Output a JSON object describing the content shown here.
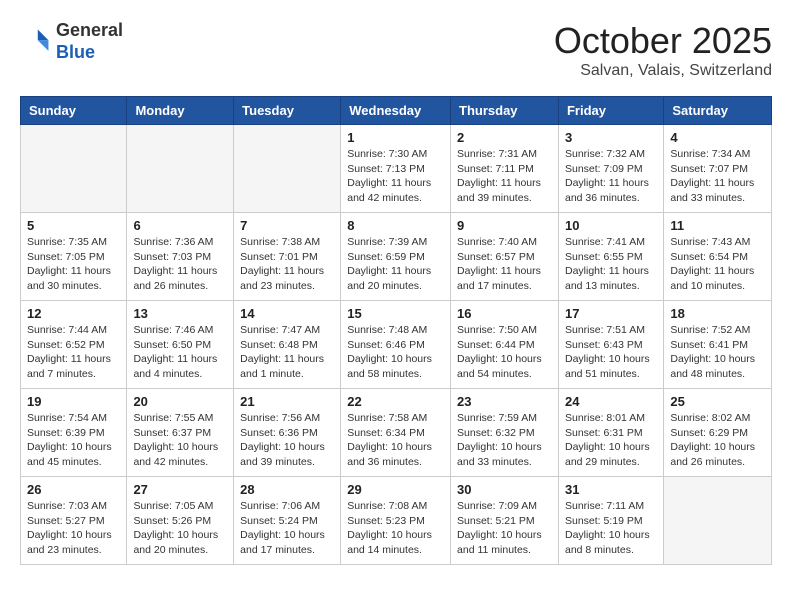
{
  "header": {
    "logo_general": "General",
    "logo_blue": "Blue",
    "month": "October 2025",
    "location": "Salvan, Valais, Switzerland"
  },
  "days_of_week": [
    "Sunday",
    "Monday",
    "Tuesday",
    "Wednesday",
    "Thursday",
    "Friday",
    "Saturday"
  ],
  "weeks": [
    [
      {
        "day": "",
        "info": ""
      },
      {
        "day": "",
        "info": ""
      },
      {
        "day": "",
        "info": ""
      },
      {
        "day": "1",
        "info": "Sunrise: 7:30 AM\nSunset: 7:13 PM\nDaylight: 11 hours\nand 42 minutes."
      },
      {
        "day": "2",
        "info": "Sunrise: 7:31 AM\nSunset: 7:11 PM\nDaylight: 11 hours\nand 39 minutes."
      },
      {
        "day": "3",
        "info": "Sunrise: 7:32 AM\nSunset: 7:09 PM\nDaylight: 11 hours\nand 36 minutes."
      },
      {
        "day": "4",
        "info": "Sunrise: 7:34 AM\nSunset: 7:07 PM\nDaylight: 11 hours\nand 33 minutes."
      }
    ],
    [
      {
        "day": "5",
        "info": "Sunrise: 7:35 AM\nSunset: 7:05 PM\nDaylight: 11 hours\nand 30 minutes."
      },
      {
        "day": "6",
        "info": "Sunrise: 7:36 AM\nSunset: 7:03 PM\nDaylight: 11 hours\nand 26 minutes."
      },
      {
        "day": "7",
        "info": "Sunrise: 7:38 AM\nSunset: 7:01 PM\nDaylight: 11 hours\nand 23 minutes."
      },
      {
        "day": "8",
        "info": "Sunrise: 7:39 AM\nSunset: 6:59 PM\nDaylight: 11 hours\nand 20 minutes."
      },
      {
        "day": "9",
        "info": "Sunrise: 7:40 AM\nSunset: 6:57 PM\nDaylight: 11 hours\nand 17 minutes."
      },
      {
        "day": "10",
        "info": "Sunrise: 7:41 AM\nSunset: 6:55 PM\nDaylight: 11 hours\nand 13 minutes."
      },
      {
        "day": "11",
        "info": "Sunrise: 7:43 AM\nSunset: 6:54 PM\nDaylight: 11 hours\nand 10 minutes."
      }
    ],
    [
      {
        "day": "12",
        "info": "Sunrise: 7:44 AM\nSunset: 6:52 PM\nDaylight: 11 hours\nand 7 minutes."
      },
      {
        "day": "13",
        "info": "Sunrise: 7:46 AM\nSunset: 6:50 PM\nDaylight: 11 hours\nand 4 minutes."
      },
      {
        "day": "14",
        "info": "Sunrise: 7:47 AM\nSunset: 6:48 PM\nDaylight: 11 hours\nand 1 minute."
      },
      {
        "day": "15",
        "info": "Sunrise: 7:48 AM\nSunset: 6:46 PM\nDaylight: 10 hours\nand 58 minutes."
      },
      {
        "day": "16",
        "info": "Sunrise: 7:50 AM\nSunset: 6:44 PM\nDaylight: 10 hours\nand 54 minutes."
      },
      {
        "day": "17",
        "info": "Sunrise: 7:51 AM\nSunset: 6:43 PM\nDaylight: 10 hours\nand 51 minutes."
      },
      {
        "day": "18",
        "info": "Sunrise: 7:52 AM\nSunset: 6:41 PM\nDaylight: 10 hours\nand 48 minutes."
      }
    ],
    [
      {
        "day": "19",
        "info": "Sunrise: 7:54 AM\nSunset: 6:39 PM\nDaylight: 10 hours\nand 45 minutes."
      },
      {
        "day": "20",
        "info": "Sunrise: 7:55 AM\nSunset: 6:37 PM\nDaylight: 10 hours\nand 42 minutes."
      },
      {
        "day": "21",
        "info": "Sunrise: 7:56 AM\nSunset: 6:36 PM\nDaylight: 10 hours\nand 39 minutes."
      },
      {
        "day": "22",
        "info": "Sunrise: 7:58 AM\nSunset: 6:34 PM\nDaylight: 10 hours\nand 36 minutes."
      },
      {
        "day": "23",
        "info": "Sunrise: 7:59 AM\nSunset: 6:32 PM\nDaylight: 10 hours\nand 33 minutes."
      },
      {
        "day": "24",
        "info": "Sunrise: 8:01 AM\nSunset: 6:31 PM\nDaylight: 10 hours\nand 29 minutes."
      },
      {
        "day": "25",
        "info": "Sunrise: 8:02 AM\nSunset: 6:29 PM\nDaylight: 10 hours\nand 26 minutes."
      }
    ],
    [
      {
        "day": "26",
        "info": "Sunrise: 7:03 AM\nSunset: 5:27 PM\nDaylight: 10 hours\nand 23 minutes."
      },
      {
        "day": "27",
        "info": "Sunrise: 7:05 AM\nSunset: 5:26 PM\nDaylight: 10 hours\nand 20 minutes."
      },
      {
        "day": "28",
        "info": "Sunrise: 7:06 AM\nSunset: 5:24 PM\nDaylight: 10 hours\nand 17 minutes."
      },
      {
        "day": "29",
        "info": "Sunrise: 7:08 AM\nSunset: 5:23 PM\nDaylight: 10 hours\nand 14 minutes."
      },
      {
        "day": "30",
        "info": "Sunrise: 7:09 AM\nSunset: 5:21 PM\nDaylight: 10 hours\nand 11 minutes."
      },
      {
        "day": "31",
        "info": "Sunrise: 7:11 AM\nSunset: 5:19 PM\nDaylight: 10 hours\nand 8 minutes."
      },
      {
        "day": "",
        "info": ""
      }
    ]
  ]
}
